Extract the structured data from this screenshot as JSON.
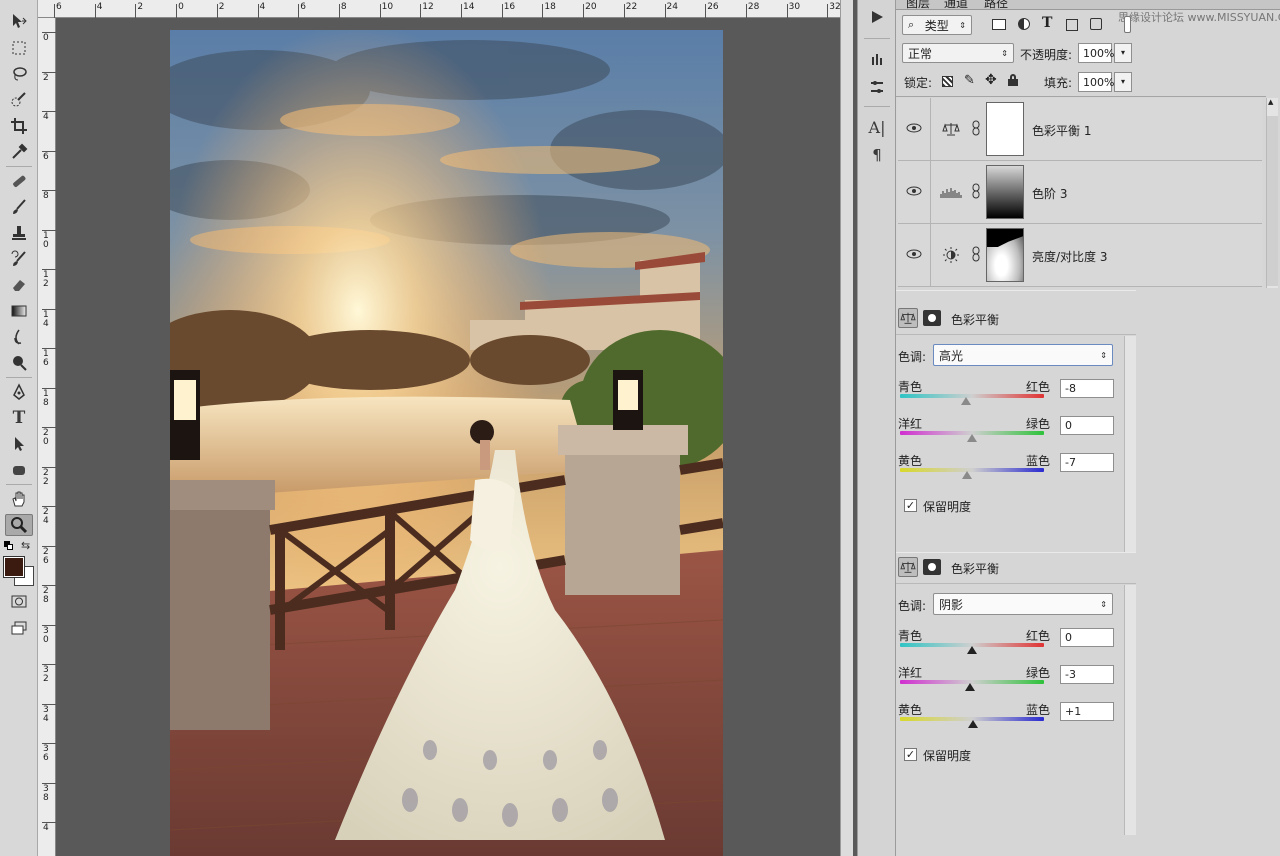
{
  "watermark": "思缘设计论坛 www.MISSYUAN.COM",
  "ruler": {
    "top": [
      "6",
      "4",
      "2",
      "0",
      "2",
      "4",
      "6",
      "8",
      "10",
      "12",
      "14",
      "16",
      "18",
      "20",
      "22",
      "24",
      "26",
      "28",
      "30",
      "32"
    ],
    "left": [
      "0",
      "2",
      "4",
      "6",
      "8",
      "1\n0",
      "1\n2",
      "1\n4",
      "1\n6",
      "1\n8",
      "2\n0",
      "2\n2",
      "2\n4",
      "2\n6",
      "2\n8",
      "3\n0",
      "3\n2",
      "3\n4",
      "3\n6",
      "3\n8",
      "4"
    ]
  },
  "tools": [
    "move",
    "marquee",
    "lasso",
    "quick-select",
    "crop",
    "eyedropper",
    "healing",
    "brush",
    "stamp",
    "history-brush",
    "eraser",
    "gradient",
    "blur",
    "dodge",
    "pen",
    "type",
    "path-select",
    "shape",
    "hand",
    "zoom"
  ],
  "colors": {
    "foreground": "#3b1b0f",
    "background": "#ffffff"
  },
  "panel": {
    "tabs": [
      "图层",
      "通道",
      "路径"
    ],
    "filter": {
      "icon": "search-icon",
      "label": "类型"
    },
    "blend_mode": "正常",
    "opacity_label": "不透明度:",
    "opacity": "100%",
    "lock_label": "锁定:",
    "fill_label": "填充:",
    "fill": "100%",
    "layers": [
      {
        "name": "色彩平衡 1",
        "icon": "balance-icon",
        "thumb": "white"
      },
      {
        "name": "色阶 3",
        "icon": "levels-icon",
        "thumb": "gradient"
      },
      {
        "name": "亮度/对比度 3",
        "icon": "brightness-icon",
        "thumb": "mask"
      }
    ]
  },
  "adjust1": {
    "title": "色彩平衡",
    "tone_label": "色调:",
    "tone": "高光",
    "rows": [
      {
        "left": "青色",
        "right": "红色",
        "value": "-8",
        "pos": -8
      },
      {
        "left": "洋红",
        "right": "绿色",
        "value": "0",
        "pos": 0
      },
      {
        "left": "黄色",
        "right": "蓝色",
        "value": "-7",
        "pos": -7
      }
    ],
    "preserve": "保留明度"
  },
  "adjust2": {
    "title": "色彩平衡",
    "tone_label": "色调:",
    "tone": "阴影",
    "rows": [
      {
        "left": "青色",
        "right": "红色",
        "value": "0",
        "pos": 0
      },
      {
        "left": "洋红",
        "right": "绿色",
        "value": "-3",
        "pos": -3
      },
      {
        "left": "黄色",
        "right": "蓝色",
        "value": "+1",
        "pos": 1
      }
    ],
    "preserve": "保留明度"
  }
}
